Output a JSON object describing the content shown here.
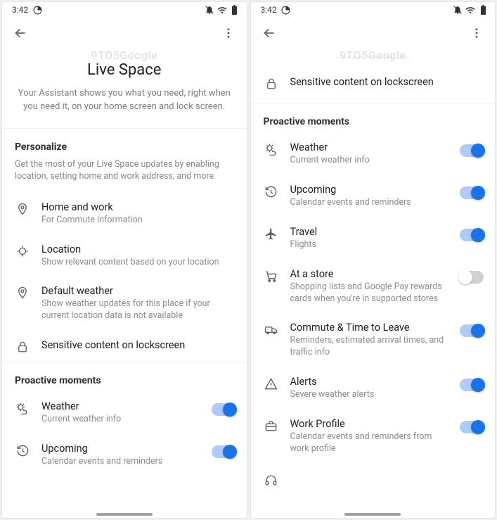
{
  "left": {
    "status": {
      "time": "3:42"
    },
    "watermark": "9TO5Google",
    "hero": {
      "title": "Live Space",
      "desc": "Your Assistant shows you what you need, right when you need it, on your home screen and lock screen."
    },
    "personalize": {
      "header": "Personalize",
      "desc": "Get the most of your Live Space updates by enabling location, setting home and work address, and more.",
      "items": [
        {
          "title": "Home and work",
          "sub": "For Commute information"
        },
        {
          "title": "Location",
          "sub": "Show relevant content based on your location"
        },
        {
          "title": "Default weather",
          "sub": "Show weather updates for this place if your current location data is not available"
        },
        {
          "title": "Sensitive content on lockscreen",
          "sub": ""
        }
      ]
    },
    "proactive": {
      "header": "Proactive moments",
      "items": [
        {
          "title": "Weather",
          "sub": "Current weather info",
          "on": true
        },
        {
          "title": "Upcoming",
          "sub": "Calendar events and reminders",
          "on": true
        }
      ]
    }
  },
  "right": {
    "status": {
      "time": "3:42"
    },
    "watermark": "9TO5Google",
    "topRow": {
      "title": "Sensitive content on lockscreen"
    },
    "proactive": {
      "header": "Proactive moments",
      "items": [
        {
          "title": "Weather",
          "sub": "Current weather info",
          "on": true
        },
        {
          "title": "Upcoming",
          "sub": "Calendar events and reminders",
          "on": true
        },
        {
          "title": "Travel",
          "sub": "Flights",
          "on": true
        },
        {
          "title": "At a store",
          "sub": "Shopping lists and Google Pay rewards cards when you're in supported stores",
          "on": false
        },
        {
          "title": "Commute & Time to Leave",
          "sub": "Reminders, estimated arrival times, and traffic info",
          "on": true
        },
        {
          "title": "Alerts",
          "sub": "Severe weather alerts",
          "on": true
        },
        {
          "title": "Work Profile",
          "sub": "Calendar events and reminders from work profile",
          "on": true
        }
      ]
    }
  }
}
